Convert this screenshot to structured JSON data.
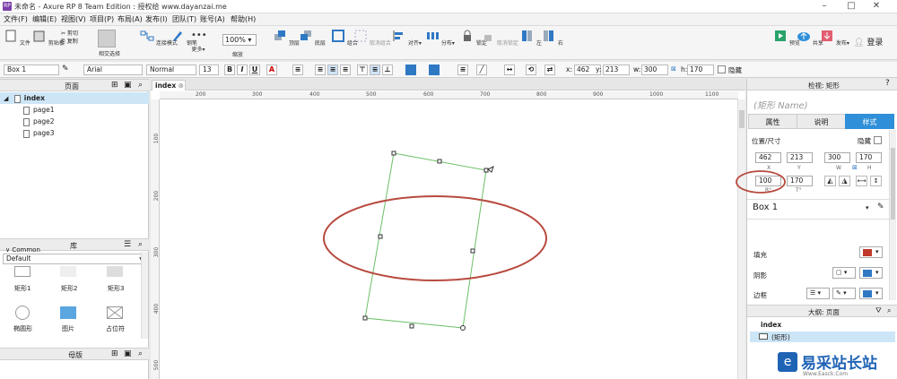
{
  "window": {
    "title": "未命名 - Axure RP 8 Team Edition : 授权给 www.dayanzai.me",
    "app_icon": "RP"
  },
  "menu": [
    "文件(F)",
    "编辑(E)",
    "视图(V)",
    "项目(P)",
    "布局(A)",
    "发布(I)",
    "团队(T)",
    "账号(A)",
    "帮助(H)"
  ],
  "toolbar": {
    "file": "文件",
    "clipboard": "剪贴板",
    "cut": "剪切",
    "copy": "复制",
    "paste": "粘贴",
    "select_mode": "相交选择",
    "connect": "连接模式",
    "pen": "钢笔",
    "more": "更多▾",
    "zoom_value": "100%",
    "zoom_label": "缩放",
    "top": "顶层",
    "bottom": "底层",
    "group": "组合",
    "ungroup": "取消组合",
    "align": "对齐▾",
    "distribute": "分布▾",
    "lock": "锁定",
    "unlock": "取消锁定",
    "left": "左",
    "right": "右",
    "preview": "预览",
    "share": "共享",
    "publish": "发布▾",
    "login": "登录"
  },
  "format": {
    "shape_name": "Box 1",
    "font": "Arial",
    "weight": "Normal",
    "size": "13",
    "x_label": "x:",
    "x": "462",
    "y_label": "y:",
    "y": "213",
    "w_label": "w:",
    "w": "300",
    "h_label": "h:",
    "h": "170",
    "hidden": "隐藏"
  },
  "pages_panel": {
    "title": "页面",
    "root": "index",
    "pages": [
      "page1",
      "page2",
      "page3"
    ]
  },
  "library_panel": {
    "title": "库",
    "library": "Default",
    "group": "Common",
    "widgets": [
      "矩形1",
      "矩形2",
      "矩形3",
      "椭圆形",
      "图片",
      "占位符"
    ]
  },
  "masters_panel": {
    "title": "母版"
  },
  "canvas": {
    "tab": "index",
    "hruler_labels": [
      "200",
      "300",
      "400",
      "500",
      "600",
      "700",
      "800",
      "900",
      "1000",
      "1100"
    ],
    "vruler_labels": [
      "100",
      "200",
      "300",
      "400",
      "500"
    ]
  },
  "inspector": {
    "header": "检视: 矩形",
    "name_placeholder": "(矩形 Name)",
    "tabs": [
      "属性",
      "说明",
      "样式"
    ],
    "pos_size_label": "位置/尺寸",
    "hidden_label": "隐藏",
    "x": "462",
    "y": "213",
    "w": "300",
    "h": "170",
    "x_sub": "X",
    "y_sub": "Y",
    "w_sub": "W",
    "h_sub": "H",
    "rotation": "100",
    "text_rotation": "170",
    "rot_sub": "R°",
    "trot_sub": "T°",
    "style_name": "Box 1",
    "fill_label": "填充",
    "shadow_label": "阴影",
    "border_label": "边框",
    "fill_color": "#c0392b",
    "shadow_color": "#2f78c4"
  },
  "outline": {
    "title": "大纲: 页面",
    "root": "index",
    "item": "(矩形)"
  },
  "watermark": {
    "text": "易采站长站",
    "sub": "Www.Easck.Com"
  },
  "colors": {
    "accent": "#2f8fd8",
    "annotation": "#b84a3f",
    "selection": "#6cc067"
  }
}
